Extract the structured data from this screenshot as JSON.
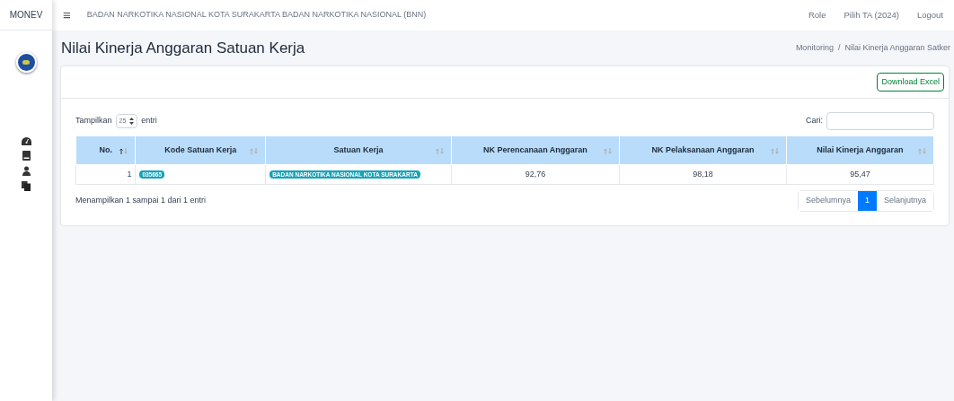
{
  "sidebar": {
    "brand": "MONEV",
    "items": [
      {
        "kind": "gauge"
      },
      {
        "kind": "book"
      },
      {
        "kind": "user"
      },
      {
        "kind": "copy"
      }
    ]
  },
  "topbar": {
    "menu_icon": "≡",
    "title": "BADAN NARKOTIKA NASIONAL KOTA SURAKARTA BADAN NARKOTIKA NASIONAL (BNN)",
    "links": [
      "Role",
      "Pilih TA (2024)",
      "Logout"
    ]
  },
  "page": {
    "title": "Nilai Kinerja Anggaran Satuan Kerja",
    "breadcrumb": [
      "Monitoring",
      "Nilai Kinerja Anggaran Satker"
    ],
    "breadcrumb_separator": "/"
  },
  "card": {
    "download_button": "Download Excel",
    "length": {
      "label_before": "Tampilkan",
      "value": "25",
      "label_after": "entri"
    },
    "search": {
      "label": "Cari:"
    },
    "table": {
      "columns": [
        {
          "label": "No.",
          "sorted": true
        },
        {
          "label": "Kode Satuan Kerja",
          "sorted": false
        },
        {
          "label": "Satuan Kerja",
          "sorted": false
        },
        {
          "label": "NK Perencanaan Anggaran",
          "sorted": false
        },
        {
          "label": "NK Pelaksanaan Anggaran",
          "sorted": false
        },
        {
          "label": "Nilai Kinerja Anggaran",
          "sorted": false
        }
      ],
      "rows": [
        {
          "no": "1",
          "kode": "035665",
          "satker": "BADAN NARKOTIKA NASIONAL KOTA SURAKARTA",
          "perencanaan": "92,76",
          "pelaksanaan": "98,18",
          "nilai": "95,47"
        }
      ]
    },
    "info": "Menampilkan 1 sampai 1 dari 1 entri",
    "pagination": [
      {
        "label": "Sebelumnya",
        "selected": false
      },
      {
        "label": "1",
        "selected": true
      },
      {
        "label": "Selanjutnya",
        "selected": false
      }
    ]
  }
}
